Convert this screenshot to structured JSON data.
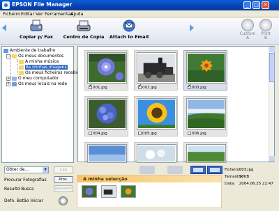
{
  "window": {
    "title": "EPSON File Manager",
    "controls": [
      "_",
      "□",
      "✕"
    ]
  },
  "menu": [
    "Ficheiro",
    "Editar",
    "Ver",
    "Ferramentas",
    "Ajuda"
  ],
  "toolbar": {
    "buttons": [
      {
        "label": "Copiar p/ Fax",
        "icon": "fax-copy-icon"
      },
      {
        "label": "Centro de Copia",
        "icon": "copy-center-icon"
      },
      {
        "label": "Attach to Email",
        "icon": "email-attach-icon"
      }
    ],
    "right_buttons": [
      {
        "label_line1": "Custom",
        "label_line2": "A"
      },
      {
        "label_line1": "Print",
        "label_line2": "B"
      }
    ]
  },
  "tree": [
    {
      "label": "Ambiente de trabalho",
      "level": 0,
      "icon": "desktop-icon",
      "expander": ""
    },
    {
      "label": "Os meus documentos",
      "level": 1,
      "icon": "folder-icon",
      "expander": "−"
    },
    {
      "label": "A minha música",
      "level": 2,
      "icon": "music-folder-icon",
      "expander": ""
    },
    {
      "label": "As minhas imagens",
      "level": 2,
      "icon": "pictures-folder-icon",
      "expander": "",
      "selected": true
    },
    {
      "label": "Os meus ficheiros recebidos",
      "level": 2,
      "icon": "folder-icon",
      "expander": ""
    },
    {
      "label": "O meu computador",
      "level": 1,
      "icon": "computer-icon",
      "expander": "+"
    },
    {
      "label": "Os meus locais na rede",
      "level": 1,
      "icon": "network-icon",
      "expander": "+"
    }
  ],
  "thumbnails": [
    {
      "name": "001.jpg",
      "checked": true,
      "selected": false,
      "scene": "morning-glory"
    },
    {
      "name": "002.jpg",
      "checked": true,
      "selected": false,
      "scene": "steam-train"
    },
    {
      "name": "003.jpg",
      "checked": true,
      "selected": true,
      "scene": "orange-flower"
    },
    {
      "name": "004.jpg",
      "checked": false,
      "selected": false,
      "scene": "hydrangea"
    },
    {
      "name": "005.jpg",
      "checked": false,
      "selected": false,
      "scene": "sunflower"
    },
    {
      "name": "006.jpg",
      "checked": false,
      "selected": false,
      "scene": "meadow"
    },
    {
      "name": "",
      "checked": false,
      "selected": false,
      "scene": "sky"
    },
    {
      "name": "",
      "checked": false,
      "selected": false,
      "scene": "white-flowers"
    },
    {
      "name": "",
      "checked": false,
      "selected": false,
      "scene": "grass"
    }
  ],
  "bottom": {
    "obter": "Obter de...",
    "can": "Can",
    "procurar": "Procurar Fotografias",
    "proc": "Proc.",
    "resultado": "Resultd Busca",
    "apresent": "Apresent",
    "defn": "Defn. Botão Iniciar"
  },
  "selection": {
    "header": "A minha selecção",
    "count": 3
  },
  "info": {
    "file_label": "Ficheiro:",
    "file_value": "003.jpg",
    "size_label": "Tamanho:",
    "size_value": "50KB",
    "date_label": "Data:",
    "date_value": "2004.06.25 22:47"
  },
  "colors": {
    "title_blue": "#0842b0",
    "selection_orange": "#f6c46b",
    "tree_selected": "#316ac5"
  }
}
